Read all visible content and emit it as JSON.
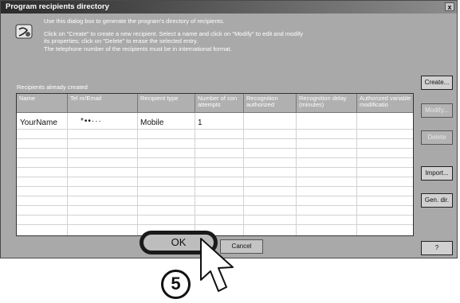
{
  "window": {
    "title": "Program recipients directory",
    "close_glyph": "x"
  },
  "intro": {
    "line1": "Use this dialog box to generate the program's directory of recipients.",
    "line2": "Click on \"Create\" to create a new recipient. Select a name and click on \"Modify\" to edit and modify",
    "line3": "its properties; click on \"Delete\" to erase the selected entry.",
    "line4": "The telephone number of the recipients must be in international format."
  },
  "recipients_label": "Recipients already created",
  "table": {
    "columns": [
      "Name",
      "Tel nr/Email",
      "Recipient type",
      "Number of con attempts",
      "Recognition authorized",
      "Recognition delay (minutes)",
      "Authorized variable modificatio"
    ],
    "rows": [
      [
        "YourName",
        "*••···",
        "Mobile",
        "1",
        "",
        "",
        ""
      ]
    ]
  },
  "side_buttons": {
    "create": "Create...",
    "modify": "Modify...",
    "delete": "Delete",
    "import": "Import...",
    "gen_dir": "Gen. dir.",
    "help": "?"
  },
  "footer": {
    "ok": "OK",
    "cancel": "Cancel"
  },
  "annotation": {
    "step_number": "5"
  },
  "icons": [
    "info-icon",
    "mouse-cursor-icon",
    "close-icon"
  ],
  "colors": {
    "dialog_bg": "#a9a9a9",
    "titlebar": "#2b2b2b",
    "highlight_ring": "#1a1a1a"
  }
}
